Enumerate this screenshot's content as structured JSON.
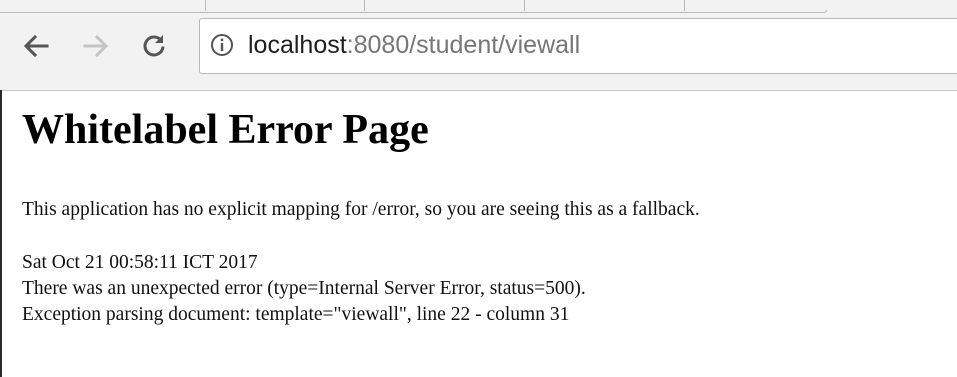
{
  "browser": {
    "url_host": "localhost",
    "url_path": ":8080/student/viewall",
    "back_icon": "arrow-left-icon",
    "forward_icon": "arrow-right-icon",
    "reload_icon": "reload-icon",
    "info_icon": "info-icon"
  },
  "page": {
    "title": "Whitelabel Error Page",
    "message": "This application has no explicit mapping for /error, so you are seeing this as a fallback.",
    "timestamp": "Sat Oct 21 00:58:11 ICT 2017",
    "error_line": "There was an unexpected error (type=Internal Server Error, status=500).",
    "exception_line": "Exception parsing document: template=\"viewall\", line 22 - column 31"
  }
}
